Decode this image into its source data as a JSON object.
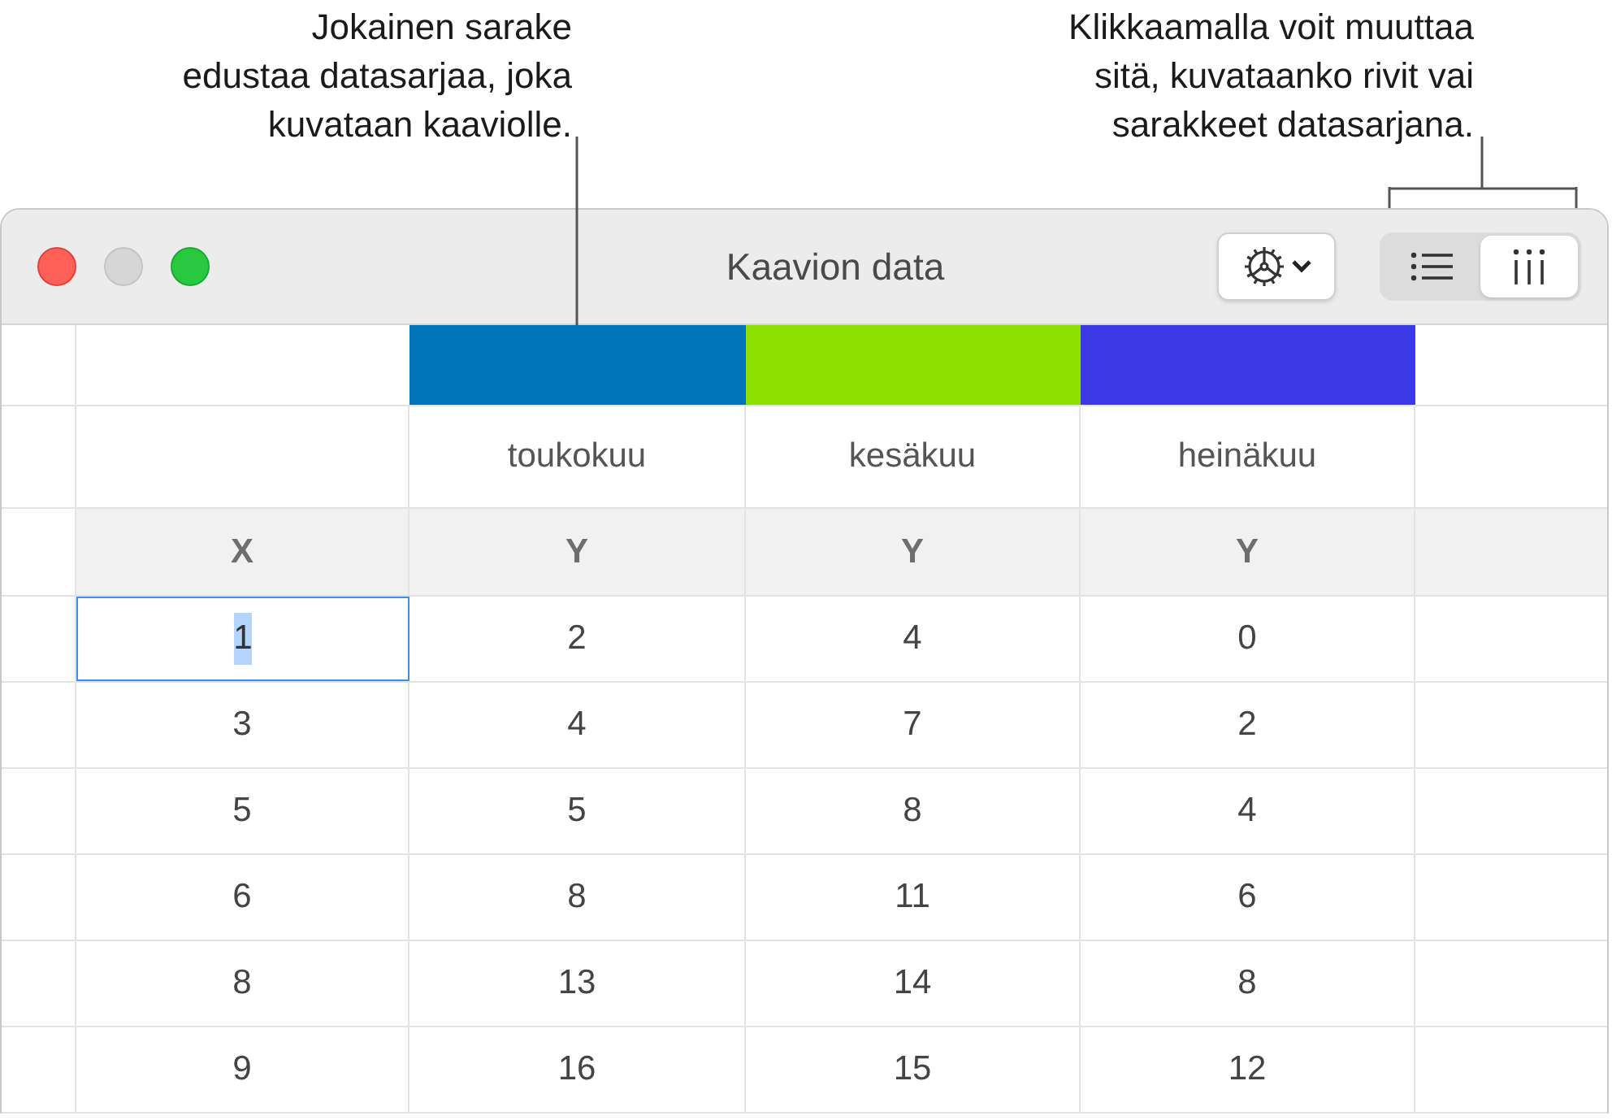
{
  "callouts": [
    {
      "text": "Jokainen sarake\nedustaa datasarjaa, joka\nkuvataan kaaviolle."
    },
    {
      "text": "Klikkaamalla voit muuttaa\nsitä, kuvataanko rivit vai\nsarakkeet datasarjana."
    }
  ],
  "window": {
    "title": "Kaavion data"
  },
  "view_toggle": [
    {
      "kind": "rows",
      "selected": false
    },
    {
      "kind": "columns",
      "selected": true
    }
  ],
  "table": {
    "series": [
      {
        "name": "toukokuu",
        "color": "#0074bb"
      },
      {
        "name": "kesäkuu",
        "color": "#8de000"
      },
      {
        "name": "heinäkuu",
        "color": "#3b38e5"
      }
    ],
    "axis_labels": [
      "X",
      "Y",
      "Y",
      "Y"
    ],
    "rows": [
      {
        "cells": [
          {
            "text": "1",
            "selected": true
          },
          {
            "text": "2",
            "selected": false
          },
          {
            "text": "4",
            "selected": false
          },
          {
            "text": "0",
            "selected": false
          }
        ]
      },
      {
        "cells": [
          {
            "text": "3",
            "selected": false
          },
          {
            "text": "4",
            "selected": false
          },
          {
            "text": "7",
            "selected": false
          },
          {
            "text": "2",
            "selected": false
          }
        ]
      },
      {
        "cells": [
          {
            "text": "5",
            "selected": false
          },
          {
            "text": "5",
            "selected": false
          },
          {
            "text": "8",
            "selected": false
          },
          {
            "text": "4",
            "selected": false
          }
        ]
      },
      {
        "cells": [
          {
            "text": "6",
            "selected": false
          },
          {
            "text": "8",
            "selected": false
          },
          {
            "text": "11",
            "selected": false
          },
          {
            "text": "6",
            "selected": false
          }
        ]
      },
      {
        "cells": [
          {
            "text": "8",
            "selected": false
          },
          {
            "text": "13",
            "selected": false
          },
          {
            "text": "14",
            "selected": false
          },
          {
            "text": "8",
            "selected": false
          }
        ]
      },
      {
        "cells": [
          {
            "text": "9",
            "selected": false
          },
          {
            "text": "16",
            "selected": false
          },
          {
            "text": "15",
            "selected": false
          },
          {
            "text": "12",
            "selected": false
          }
        ]
      }
    ]
  }
}
